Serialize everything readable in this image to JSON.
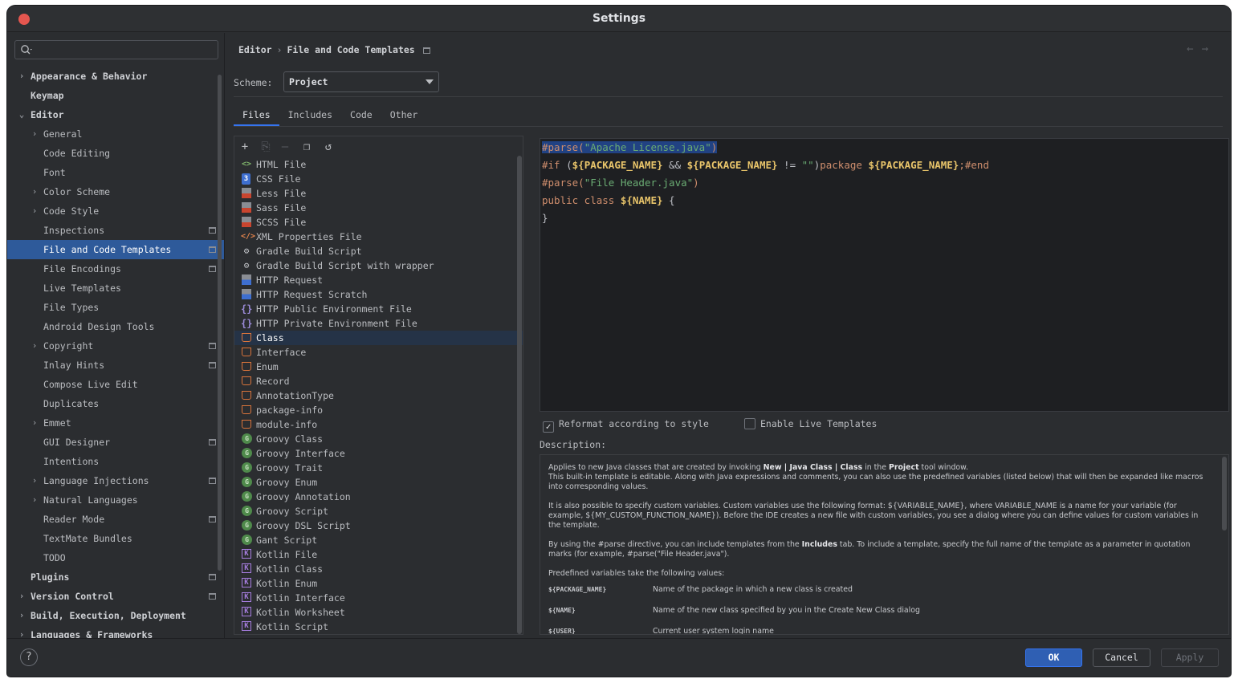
{
  "window": {
    "title": "Settings"
  },
  "sidebar": {
    "search_placeholder": "",
    "items": [
      {
        "label": "Appearance & Behavior",
        "level": 0,
        "expandable": true,
        "expanded": false,
        "bold": true
      },
      {
        "label": "Keymap",
        "level": 0,
        "expandable": false,
        "bold": true
      },
      {
        "label": "Editor",
        "level": 0,
        "expandable": true,
        "expanded": true,
        "bold": true
      },
      {
        "label": "General",
        "level": 1,
        "expandable": true,
        "expanded": false
      },
      {
        "label": "Code Editing",
        "level": 1
      },
      {
        "label": "Font",
        "level": 1
      },
      {
        "label": "Color Scheme",
        "level": 1,
        "expandable": true,
        "expanded": false
      },
      {
        "label": "Code Style",
        "level": 1,
        "expandable": true,
        "expanded": false
      },
      {
        "label": "Inspections",
        "level": 1,
        "project": true
      },
      {
        "label": "File and Code Templates",
        "level": 1,
        "project": true,
        "selected": true
      },
      {
        "label": "File Encodings",
        "level": 1,
        "project": true
      },
      {
        "label": "Live Templates",
        "level": 1
      },
      {
        "label": "File Types",
        "level": 1
      },
      {
        "label": "Android Design Tools",
        "level": 1
      },
      {
        "label": "Copyright",
        "level": 1,
        "expandable": true,
        "expanded": false,
        "project": true
      },
      {
        "label": "Inlay Hints",
        "level": 1,
        "project": true
      },
      {
        "label": "Compose Live Edit",
        "level": 1
      },
      {
        "label": "Duplicates",
        "level": 1
      },
      {
        "label": "Emmet",
        "level": 1,
        "expandable": true,
        "expanded": false
      },
      {
        "label": "GUI Designer",
        "level": 1,
        "project": true
      },
      {
        "label": "Intentions",
        "level": 1
      },
      {
        "label": "Language Injections",
        "level": 1,
        "expandable": true,
        "expanded": false,
        "project": true
      },
      {
        "label": "Natural Languages",
        "level": 1,
        "expandable": true,
        "expanded": false
      },
      {
        "label": "Reader Mode",
        "level": 1,
        "project": true
      },
      {
        "label": "TextMate Bundles",
        "level": 1
      },
      {
        "label": "TODO",
        "level": 1
      },
      {
        "label": "Plugins",
        "level": 0,
        "bold": true,
        "project": true
      },
      {
        "label": "Version Control",
        "level": 0,
        "expandable": true,
        "expanded": false,
        "bold": true,
        "project": true
      },
      {
        "label": "Build, Execution, Deployment",
        "level": 0,
        "expandable": true,
        "expanded": false,
        "bold": true
      },
      {
        "label": "Languages & Frameworks",
        "level": 0,
        "expandable": true,
        "expanded": false,
        "bold": true
      }
    ]
  },
  "header": {
    "breadcrumb": [
      "Editor",
      "File and Code Templates"
    ],
    "back_icon": "arrow-left-icon",
    "forward_icon": "arrow-right-icon"
  },
  "scheme": {
    "label": "Scheme:",
    "value": "Project"
  },
  "tabs": [
    {
      "label": "Files",
      "active": true
    },
    {
      "label": "Includes"
    },
    {
      "label": "Code"
    },
    {
      "label": "Other"
    }
  ],
  "toolbar": {
    "add": "+",
    "copy_disabled": "⎘",
    "remove": "—",
    "duplicate": "❐",
    "reset": "↺"
  },
  "templates": [
    {
      "label": "HTML File",
      "icon": "html",
      "glyph": "<>"
    },
    {
      "label": "CSS File",
      "icon": "css",
      "glyph": "3"
    },
    {
      "label": "Less File",
      "icon": "less",
      "glyph": ""
    },
    {
      "label": "Sass File",
      "icon": "sass",
      "glyph": ""
    },
    {
      "label": "SCSS File",
      "icon": "sass",
      "glyph": ""
    },
    {
      "label": "XML Properties File",
      "icon": "xml",
      "glyph": "</>"
    },
    {
      "label": "Gradle Build Script",
      "icon": "gradle",
      "glyph": "⚙"
    },
    {
      "label": "Gradle Build Script with wrapper",
      "icon": "gradle",
      "glyph": "⚙"
    },
    {
      "label": "HTTP Request",
      "icon": "http",
      "glyph": ""
    },
    {
      "label": "HTTP Request Scratch",
      "icon": "http",
      "glyph": ""
    },
    {
      "label": "HTTP Public Environment File",
      "icon": "env",
      "glyph": "{}"
    },
    {
      "label": "HTTP Private Environment File",
      "icon": "env",
      "glyph": "{}"
    },
    {
      "label": "Class",
      "icon": "java",
      "glyph": "",
      "selected": true
    },
    {
      "label": "Interface",
      "icon": "java",
      "glyph": ""
    },
    {
      "label": "Enum",
      "icon": "java",
      "glyph": ""
    },
    {
      "label": "Record",
      "icon": "java",
      "glyph": ""
    },
    {
      "label": "AnnotationType",
      "icon": "java",
      "glyph": ""
    },
    {
      "label": "package-info",
      "icon": "java",
      "glyph": ""
    },
    {
      "label": "module-info",
      "icon": "java",
      "glyph": ""
    },
    {
      "label": "Groovy Class",
      "icon": "groovy",
      "glyph": "G"
    },
    {
      "label": "Groovy Interface",
      "icon": "groovy",
      "glyph": "G"
    },
    {
      "label": "Groovy Trait",
      "icon": "groovy",
      "glyph": "G"
    },
    {
      "label": "Groovy Enum",
      "icon": "groovy",
      "glyph": "G"
    },
    {
      "label": "Groovy Annotation",
      "icon": "groovy",
      "glyph": "G"
    },
    {
      "label": "Groovy Script",
      "icon": "groovy",
      "glyph": "G"
    },
    {
      "label": "Groovy DSL Script",
      "icon": "groovy",
      "glyph": "G"
    },
    {
      "label": "Gant Script",
      "icon": "groovy",
      "glyph": "G"
    },
    {
      "label": "Kotlin File",
      "icon": "kotlin",
      "glyph": "K"
    },
    {
      "label": "Kotlin Class",
      "icon": "kotlin",
      "glyph": "K"
    },
    {
      "label": "Kotlin Enum",
      "icon": "kotlin",
      "glyph": "K"
    },
    {
      "label": "Kotlin Interface",
      "icon": "kotlin",
      "glyph": "K"
    },
    {
      "label": "Kotlin Worksheet",
      "icon": "kotlin",
      "glyph": "K"
    },
    {
      "label": "Kotlin Script",
      "icon": "kotlin",
      "glyph": "K"
    }
  ],
  "editor": {
    "lines": [
      [
        {
          "t": "#parse(",
          "c": "c-dir c-sel"
        },
        {
          "t": "\"Apache License.java\"",
          "c": "c-str c-sel"
        },
        {
          "t": ")",
          "c": "c-dir c-sel"
        }
      ],
      [
        {
          "t": "#if",
          "c": "c-dir"
        },
        {
          "t": " (",
          "c": ""
        },
        {
          "t": "${PACKAGE_NAME}",
          "c": "c-var"
        },
        {
          "t": " && ",
          "c": ""
        },
        {
          "t": "${PACKAGE_NAME}",
          "c": "c-var"
        },
        {
          "t": " != ",
          "c": ""
        },
        {
          "t": "\"\"",
          "c": "c-str"
        },
        {
          "t": ")",
          "c": ""
        },
        {
          "t": "package ",
          "c": "c-kw"
        },
        {
          "t": "${PACKAGE_NAME}",
          "c": "c-var"
        },
        {
          "t": ";",
          "c": "c-kw"
        },
        {
          "t": "#end",
          "c": "c-dir"
        }
      ],
      [
        {
          "t": "#parse(",
          "c": "c-dir"
        },
        {
          "t": "\"File Header.java\"",
          "c": "c-str"
        },
        {
          "t": ")",
          "c": "c-dir"
        }
      ],
      [
        {
          "t": "public class ",
          "c": "c-kw"
        },
        {
          "t": "${NAME}",
          "c": "c-var"
        },
        {
          "t": " {",
          "c": ""
        }
      ],
      [
        {
          "t": "}",
          "c": ""
        }
      ]
    ]
  },
  "options": {
    "reformat_label": "Reformat according to style",
    "reformat_checked": true,
    "live_templates_label": "Enable Live Templates",
    "live_templates_checked": false
  },
  "description": {
    "label": "Description:",
    "p1_pre": "Applies to new Java classes that are created by invoking ",
    "p1_b1": "New | Java Class | Class",
    "p1_mid": " in the ",
    "p1_b2": "Project",
    "p1_post": " tool window.",
    "p1_line2": "This built-in template is editable. Along with Java expressions and comments, you can also use the predefined variables (listed below) that will then be expanded like macros into corresponding values.",
    "p2": "It is also possible to specify custom variables. Custom variables use the following format: ${VARIABLE_NAME}, where VARIABLE_NAME is a name for your variable (for example, ${MY_CUSTOM_FUNCTION_NAME}). Before the IDE creates a new file with custom variables, you see a dialog where you can define values for custom variables in the template.",
    "p3_pre": "By using the #parse directive, you can include templates from the ",
    "p3_b": "Includes",
    "p3_post": " tab. To include a template, specify the full name of the template as a parameter in quotation marks (for example, #parse(\"File Header.java\").",
    "p4": "Predefined variables take the following values:",
    "vars": [
      {
        "name": "${PACKAGE_NAME}",
        "desc": "Name of the package in which a new class is created"
      },
      {
        "name": "${NAME}",
        "desc": "Name of the new class specified by you in the Create New Class dialog"
      },
      {
        "name": "${USER}",
        "desc": "Current user system login name"
      }
    ]
  },
  "footer": {
    "help": "?",
    "ok": "OK",
    "cancel": "Cancel",
    "apply": "Apply"
  },
  "colors": {
    "selection": "#2e5a9a",
    "accent": "#3574f0",
    "background": "#2b2d30",
    "editor_bg": "#1e1f22"
  }
}
